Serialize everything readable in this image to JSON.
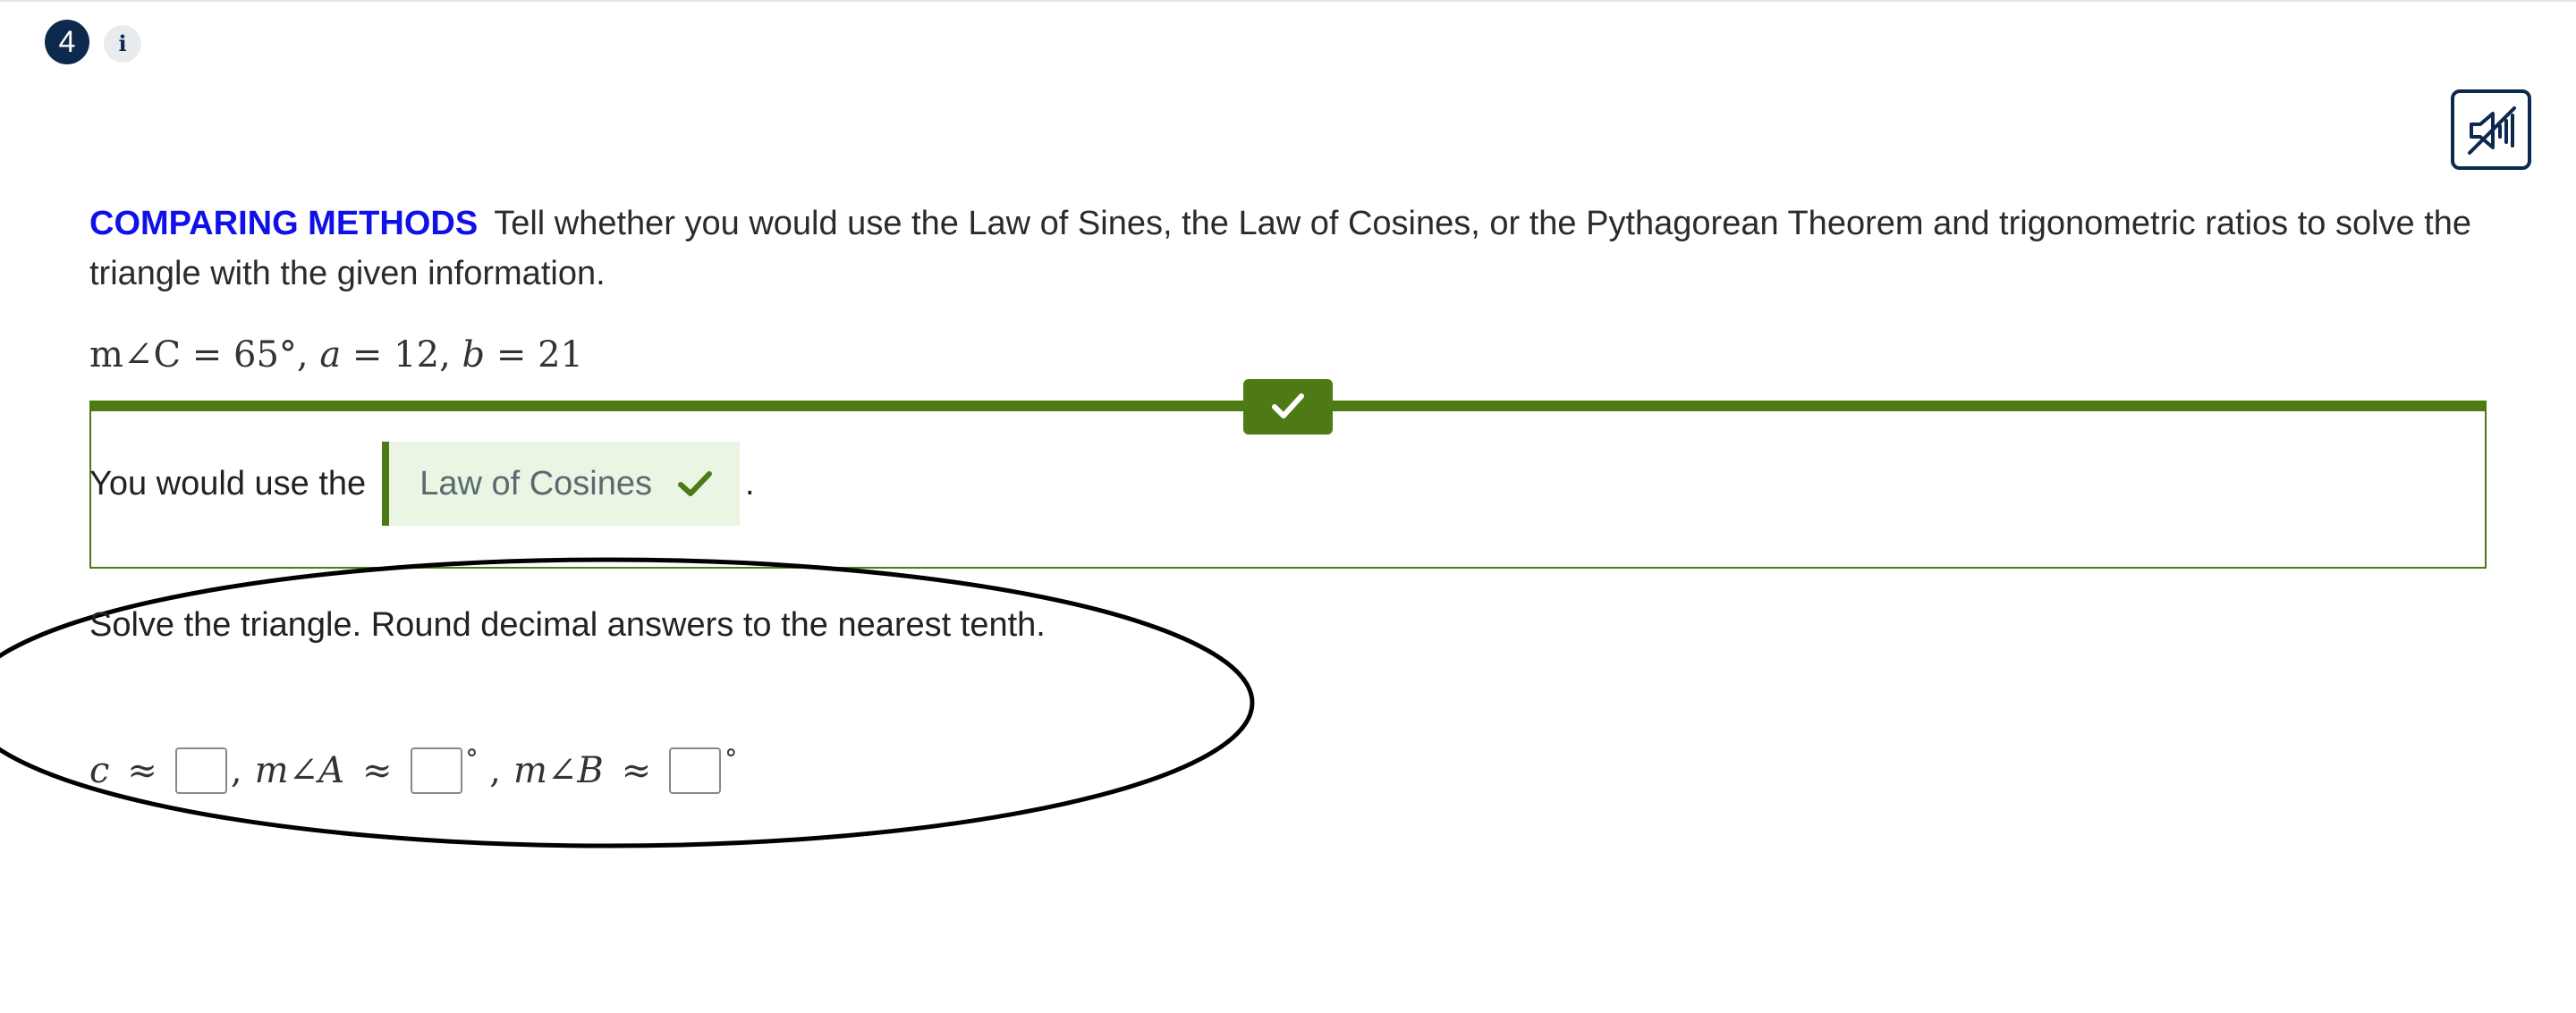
{
  "question": {
    "number": "4",
    "info_label": "i"
  },
  "prompt": {
    "tag": "COMPARING METHODS",
    "text": "Tell whether you would use the Law of Sines, the Law of Cosines, or the Pythagorean Theorem and trigonometric ratios to solve the triangle with the given information."
  },
  "given": {
    "angle_label": "m∠C",
    "angle_value": "65°",
    "a_label": "a",
    "a_value": "12",
    "b_label": "b",
    "b_value": "21"
  },
  "part1": {
    "lead_text": "You would use the",
    "answer": "Law of Cosines",
    "trailing": ".",
    "status": "correct"
  },
  "part2": {
    "instruction": "Solve the triangle. Round decimal answers to the nearest tenth.",
    "fields": [
      {
        "label": "c",
        "value": "",
        "unit": ""
      },
      {
        "label": "m∠A",
        "value": "",
        "unit": "°"
      },
      {
        "label": "m∠B",
        "value": "",
        "unit": "°"
      }
    ]
  },
  "icons": {
    "audio": "speaker-muted-icon",
    "check": "checkmark-icon"
  },
  "colors": {
    "navy": "#0d2a4e",
    "tag_blue": "#1010e8",
    "correct_green": "#4e7a16",
    "correct_bg": "#eaf5e4"
  }
}
